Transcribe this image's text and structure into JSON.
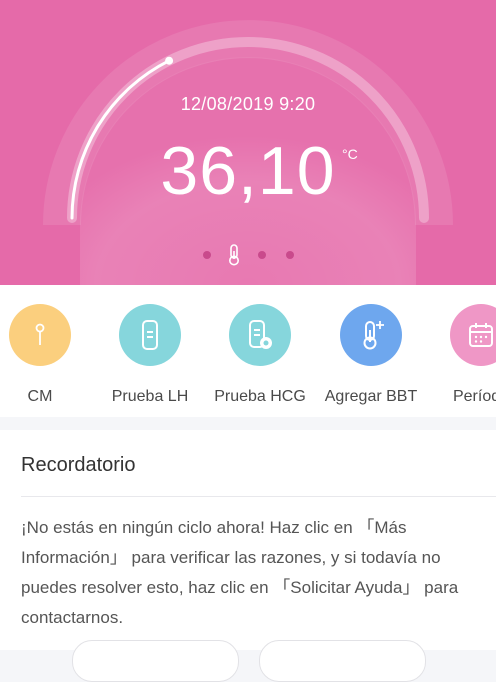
{
  "reading": {
    "datetime": "12/08/2019 9:20",
    "temperature": "36,10",
    "unit": "°C",
    "gauge_fraction": 0.22
  },
  "pager": {
    "count": 4,
    "active_index": 1,
    "active_icon": "thermometer-icon"
  },
  "actions": [
    {
      "label": "CM",
      "icon": "cervical-mucus-icon",
      "color": "#fbcf7e"
    },
    {
      "label": "Prueba LH",
      "icon": "lh-test-strip-icon",
      "color": "#86d6dc"
    },
    {
      "label": "Prueba HCG",
      "icon": "hcg-test-strip-icon",
      "color": "#86d6dc"
    },
    {
      "label": "Agregar BBT",
      "icon": "thermometer-plus-icon",
      "color": "#6ea7ee"
    },
    {
      "label": "Período",
      "icon": "calendar-icon",
      "color": "#ef97c6"
    }
  ],
  "reminder": {
    "title": "Recordatorio",
    "message": "¡No estás en ningún ciclo ahora! Haz clic en 「Más Información」 para verificar las razones, y si todavía no puedes resolver esto, haz clic en 「Solicitar Ayuda」 para contactarnos."
  },
  "colors": {
    "header": "#e56aa9",
    "accent_dot": "#c94a8c"
  }
}
